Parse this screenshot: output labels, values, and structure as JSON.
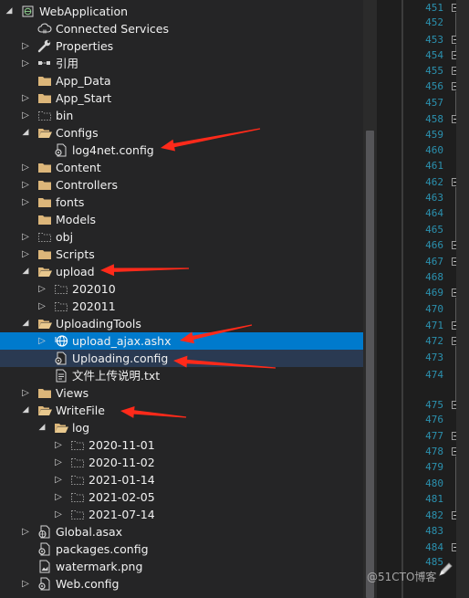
{
  "tree": [
    {
      "label": "WebApplication",
      "indent": 0,
      "expand": "open",
      "icon": "project-icon"
    },
    {
      "label": "Connected Services",
      "indent": 1,
      "expand": "none",
      "icon": "connected-services-icon"
    },
    {
      "label": "Properties",
      "indent": 1,
      "expand": "closed",
      "icon": "wrench-icon"
    },
    {
      "label": "引用",
      "indent": 1,
      "expand": "closed",
      "icon": "references-icon"
    },
    {
      "label": "App_Data",
      "indent": 1,
      "expand": "none",
      "icon": "folder-icon"
    },
    {
      "label": "App_Start",
      "indent": 1,
      "expand": "closed",
      "icon": "folder-icon"
    },
    {
      "label": "bin",
      "indent": 1,
      "expand": "closed",
      "icon": "hidden-folder-icon"
    },
    {
      "label": "Configs",
      "indent": 1,
      "expand": "open",
      "icon": "folder-open-icon"
    },
    {
      "label": "log4net.config",
      "indent": 2,
      "expand": "none",
      "icon": "config-file-icon"
    },
    {
      "label": "Content",
      "indent": 1,
      "expand": "closed",
      "icon": "folder-icon"
    },
    {
      "label": "Controllers",
      "indent": 1,
      "expand": "closed",
      "icon": "folder-icon"
    },
    {
      "label": "fonts",
      "indent": 1,
      "expand": "closed",
      "icon": "folder-icon"
    },
    {
      "label": "Models",
      "indent": 1,
      "expand": "none",
      "icon": "folder-icon"
    },
    {
      "label": "obj",
      "indent": 1,
      "expand": "closed",
      "icon": "hidden-folder-icon"
    },
    {
      "label": "Scripts",
      "indent": 1,
      "expand": "closed",
      "icon": "folder-icon"
    },
    {
      "label": "upload",
      "indent": 1,
      "expand": "open",
      "icon": "folder-open-icon"
    },
    {
      "label": "202010",
      "indent": 2,
      "expand": "closed",
      "icon": "hidden-folder-icon"
    },
    {
      "label": "202011",
      "indent": 2,
      "expand": "closed",
      "icon": "hidden-folder-icon"
    },
    {
      "label": "UploadingTools",
      "indent": 1,
      "expand": "open",
      "icon": "folder-open-icon"
    },
    {
      "label": "upload_ajax.ashx",
      "indent": 2,
      "expand": "closed",
      "icon": "web-handler-icon",
      "selected": true
    },
    {
      "label": "Uploading.config",
      "indent": 2,
      "expand": "none",
      "icon": "config-file-icon",
      "highlight": true
    },
    {
      "label": "文件上传说明.txt",
      "indent": 2,
      "expand": "none",
      "icon": "text-file-icon"
    },
    {
      "label": "Views",
      "indent": 1,
      "expand": "closed",
      "icon": "folder-icon"
    },
    {
      "label": "WriteFile",
      "indent": 1,
      "expand": "open",
      "icon": "folder-open-icon"
    },
    {
      "label": "log",
      "indent": 2,
      "expand": "open",
      "icon": "folder-open-icon"
    },
    {
      "label": "2020-11-01",
      "indent": 3,
      "expand": "closed",
      "icon": "hidden-folder-icon"
    },
    {
      "label": "2020-11-02",
      "indent": 3,
      "expand": "closed",
      "icon": "hidden-folder-icon"
    },
    {
      "label": "2021-01-14",
      "indent": 3,
      "expand": "closed",
      "icon": "hidden-folder-icon"
    },
    {
      "label": "2021-02-05",
      "indent": 3,
      "expand": "closed",
      "icon": "hidden-folder-icon"
    },
    {
      "label": "2021-07-14",
      "indent": 3,
      "expand": "closed",
      "icon": "hidden-folder-icon"
    },
    {
      "label": "Global.asax",
      "indent": 1,
      "expand": "closed",
      "icon": "global-asax-icon"
    },
    {
      "label": "packages.config",
      "indent": 1,
      "expand": "none",
      "icon": "config-file-icon"
    },
    {
      "label": "watermark.png",
      "indent": 1,
      "expand": "none",
      "icon": "image-file-icon"
    },
    {
      "label": "Web.config",
      "indent": 1,
      "expand": "closed",
      "icon": "config-file-icon"
    }
  ],
  "line_numbers": [
    "451",
    "452",
    "453",
    "454",
    "455",
    "456",
    "457",
    "458",
    "459",
    "460",
    "461",
    "462",
    "463",
    "464",
    "465",
    "466",
    "467",
    "468",
    "469",
    "470",
    "471",
    "472",
    "473",
    "474",
    "475",
    "476",
    "477",
    "478",
    "479",
    "480",
    "481",
    "482",
    "483",
    "484",
    "485"
  ],
  "watermark": "@51CTO博客",
  "colors": {
    "selection": "#007acc",
    "folder": "#dcb67a",
    "line_number": "#2b91af",
    "annotation_arrow": "#ff2a1a"
  }
}
